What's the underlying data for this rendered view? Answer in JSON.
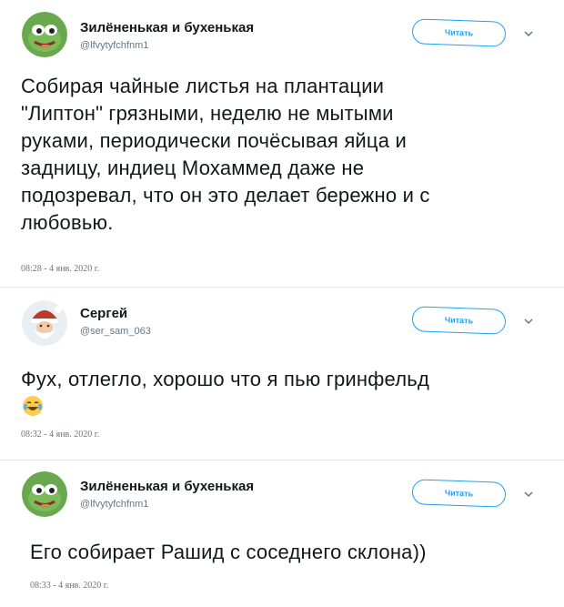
{
  "tweets": [
    {
      "display_name": "Зилёненькая и бухенькая",
      "handle": "@lfvytyfchfnm1",
      "follow_label": "Читать",
      "lines": [
        "Собирая чайные листья на плантации",
        "\"Липтон\" грязными, неделю не мытыми",
        "руками, периодически почёсывая яйца и",
        "задницу, индиец Мохаммед даже не",
        "подозревал, что он это делает бережно и с",
        "любовью."
      ],
      "timestamp": "08:28 - 4 янв. 2020 г."
    },
    {
      "display_name": "Сергей",
      "handle": "@ser_sam_063",
      "follow_label": "Читать",
      "lines": [
        "Фух, отлегло, хорошо что я пью гринфельд"
      ],
      "emoji": "laughing-tears-emoji",
      "timestamp": "08:32 - 4 янв. 2020 г."
    },
    {
      "display_name": "Зилёненькая и бухенькая",
      "handle": "@lfvytyfchfnm1",
      "follow_label": "Читать",
      "lines": [
        "Его собирает Рашид с соседнего склона))"
      ],
      "timestamp": "08:33 - 4 янв. 2020 г."
    }
  ],
  "colors": {
    "accent": "#1da1f2",
    "text": "#14171a",
    "muted": "#657786",
    "avatar_green": "#6aa84f"
  },
  "icons": [
    "chevron-down-icon",
    "pepe-avatar",
    "santa-avatar",
    "laughing-tears-emoji"
  ]
}
